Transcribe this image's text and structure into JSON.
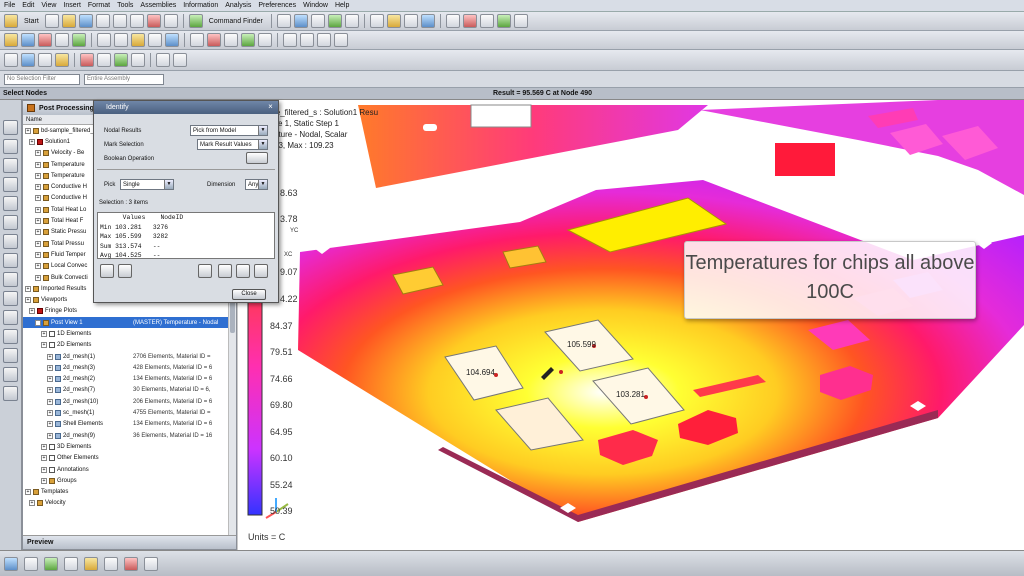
{
  "menu": [
    "File",
    "Edit",
    "View",
    "Insert",
    "Format",
    "Tools",
    "Assemblies",
    "Information",
    "Analysis",
    "Preferences",
    "Window",
    "Help"
  ],
  "toolbar": {
    "start_label": "Start",
    "command_finder_label": "Command Finder"
  },
  "filterbar": {
    "selection_filter": "No Selection Filter",
    "assembly": "Entire Assembly"
  },
  "status": {
    "left": "Select Nodes",
    "result": "Result = 95.569 C at Node 490"
  },
  "navigator": {
    "title": "Post Processing",
    "column": "Name",
    "rows": [
      {
        "label": "bd-sample_filtered_",
        "detail": ""
      },
      {
        "label": "Solution1",
        "detail": ""
      },
      {
        "label": "Velocity - Be",
        "detail": ""
      },
      {
        "label": "Temperature",
        "detail": ""
      },
      {
        "label": "Temperature",
        "detail": ""
      },
      {
        "label": "Conductive H",
        "detail": ""
      },
      {
        "label": "Conductive H",
        "detail": ""
      },
      {
        "label": "Total Heat Lo",
        "detail": ""
      },
      {
        "label": "Total Heat F",
        "detail": ""
      },
      {
        "label": "Static Pressu",
        "detail": ""
      },
      {
        "label": "Total Pressu",
        "detail": ""
      },
      {
        "label": "Fluid Temper",
        "detail": ""
      },
      {
        "label": "Local Convec",
        "detail": ""
      },
      {
        "label": "Bulk Convecti",
        "detail": ""
      },
      {
        "label": "Imported Results",
        "detail": ""
      },
      {
        "label": "Viewports",
        "detail": ""
      },
      {
        "label": "Fringe Plots",
        "detail": ""
      },
      {
        "label": "Post View 1",
        "detail": "(MASTER) Temperature - Nodal"
      },
      {
        "label": "1D Elements",
        "detail": ""
      },
      {
        "label": "2D Elements",
        "detail": ""
      },
      {
        "label": "2d_mesh(1)",
        "detail": "2706 Elements, Material ID ="
      },
      {
        "label": "2d_mesh(3)",
        "detail": "428 Elements, Material ID = 6"
      },
      {
        "label": "2d_mesh(2)",
        "detail": "134 Elements, Material ID = 6"
      },
      {
        "label": "2d_mesh(7)",
        "detail": "30 Elements, Material ID = 6,"
      },
      {
        "label": "2d_mesh(10)",
        "detail": "206 Elements, Material ID = 6"
      },
      {
        "label": "sc_mesh(1)",
        "detail": "4755 Elements, Material ID ="
      },
      {
        "label": "Shell Elements",
        "detail": "134 Elements, Material ID = 6"
      },
      {
        "label": "2d_mesh(9)",
        "detail": "36 Elements, Material ID = 16"
      },
      {
        "label": "3D Elements",
        "detail": ""
      },
      {
        "label": "Other Elements",
        "detail": ""
      },
      {
        "label": "Annotations",
        "detail": ""
      },
      {
        "label": "Groups",
        "detail": ""
      },
      {
        "label": "Templates",
        "detail": ""
      },
      {
        "label": "Velocity",
        "detail": ""
      }
    ],
    "bottom": "Preview"
  },
  "identify": {
    "title": "Identify",
    "nodal_results_label": "Nodal Results",
    "nodal_results_value": "Pick from Model",
    "mark_selection_label": "Mark Selection",
    "mark_selection_value": "Mark Result Values",
    "boolean_label": "Boolean Operation",
    "pick_label": "Pick",
    "pick_value": "Single",
    "dimension_label": "Dimension",
    "dimension_value": "Any",
    "selection_count": "Selection : 3 items",
    "table": "      Values    NodeID\nMin 103.281   3276\nMax 105.599   3282\nSum 313.574   --\nAvg 104.525   --",
    "close_label": "Close"
  },
  "viewport": {
    "info": [
      "le_filtered_s : Solution1 Resu",
      "se 1, Static Step 1",
      "ature - Nodal, Scalar",
      "63, Max : 109.23"
    ],
    "legend_values": [
      "8.63",
      "3.78",
      "9.07",
      "4.22",
      "84.37",
      "79.51",
      "74.66",
      "69.80",
      "64.95",
      "60.10",
      "55.24",
      "50.39"
    ],
    "legend_side": [
      "YC",
      "XC"
    ],
    "units": "Units = C",
    "callout": "Temperatures for chips all above 100C",
    "chip_labels": [
      "105.599",
      "104.694",
      "103.281"
    ]
  }
}
